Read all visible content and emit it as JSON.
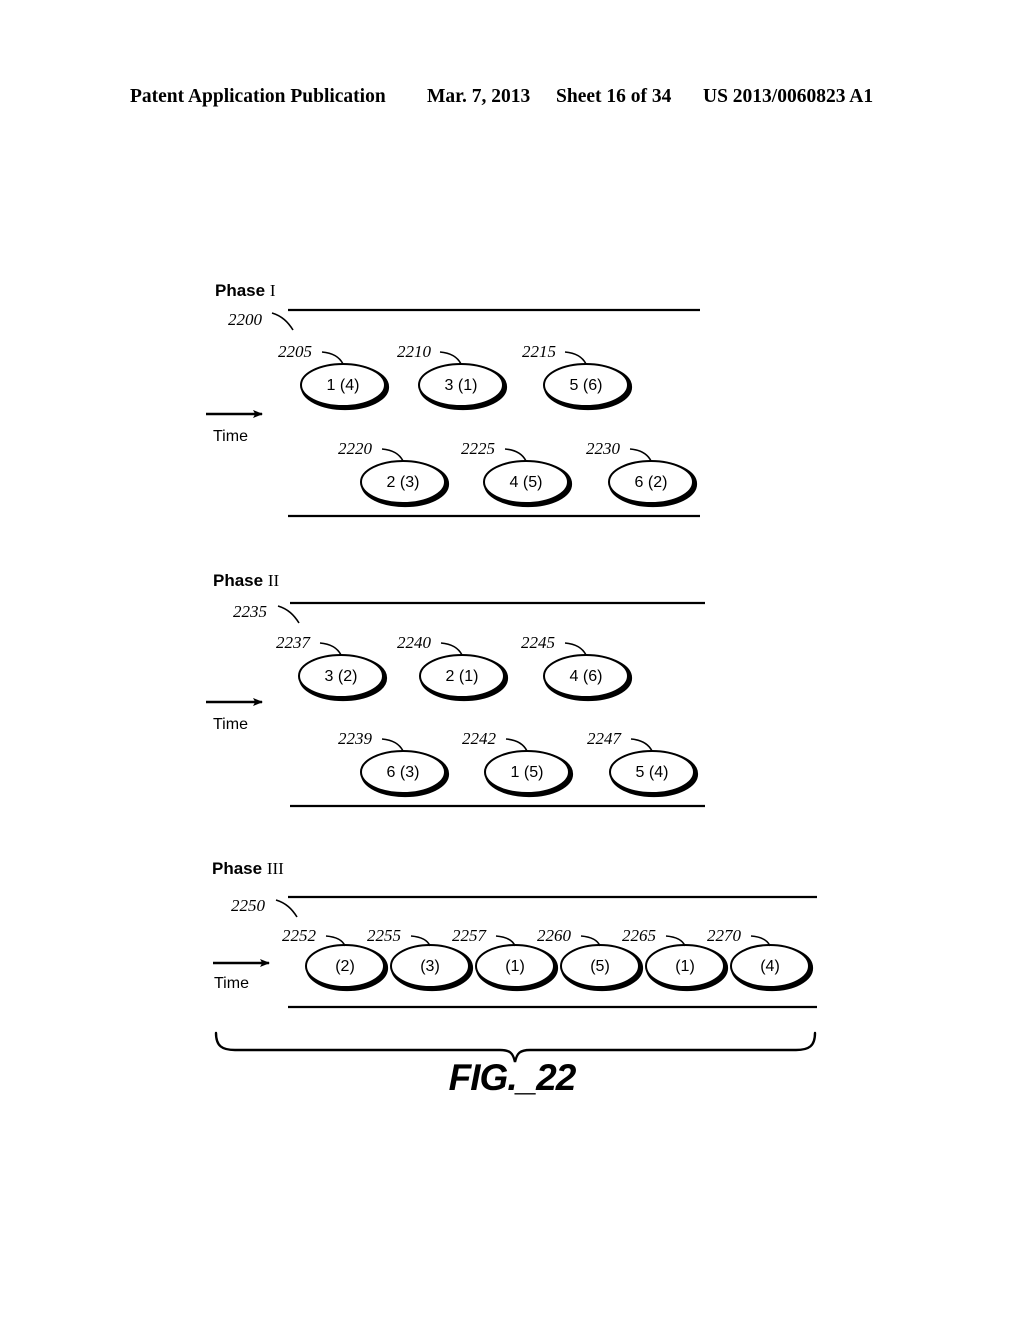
{
  "header": {
    "publication": "Patent Application Publication",
    "date": "Mar. 7, 2013",
    "sheet": "Sheet 16 of 34",
    "patent_number": "US 2013/0060823 A1"
  },
  "figure": {
    "caption": "FIG._22",
    "time_axis_label": "Time",
    "ink_color": "#000000",
    "background_color": "#ffffff"
  },
  "phases": [
    {
      "name": "Phase",
      "numeral": "I",
      "timeline_ref": "2200",
      "rows": [
        {
          "nodes": [
            {
              "ref": "2205",
              "label": "1 (4)"
            },
            {
              "ref": "2210",
              "label": "3 (1)"
            },
            {
              "ref": "2215",
              "label": "5 (6)"
            }
          ]
        },
        {
          "nodes": [
            {
              "ref": "2220",
              "label": "2 (3)"
            },
            {
              "ref": "2225",
              "label": "4 (5)"
            },
            {
              "ref": "2230",
              "label": "6 (2)"
            }
          ]
        }
      ]
    },
    {
      "name": "Phase",
      "numeral": "II",
      "timeline_ref": "2235",
      "rows": [
        {
          "nodes": [
            {
              "ref": "2237",
              "label": "3 (2)"
            },
            {
              "ref": "2240",
              "label": "2 (1)"
            },
            {
              "ref": "2245",
              "label": "4 (6)"
            }
          ]
        },
        {
          "nodes": [
            {
              "ref": "2239",
              "label": "6 (3)"
            },
            {
              "ref": "2242",
              "label": "1 (5)"
            },
            {
              "ref": "2247",
              "label": "5 (4)"
            }
          ]
        }
      ]
    },
    {
      "name": "Phase",
      "numeral": "III",
      "timeline_ref": "2250",
      "rows": [
        {
          "nodes": [
            {
              "ref": "2252",
              "label": "(2)"
            },
            {
              "ref": "2255",
              "label": "(3)"
            },
            {
              "ref": "2257",
              "label": "(1)"
            },
            {
              "ref": "2260",
              "label": "(5)"
            },
            {
              "ref": "2265",
              "label": "(1)"
            },
            {
              "ref": "2270",
              "label": "(4)"
            }
          ]
        }
      ]
    }
  ]
}
